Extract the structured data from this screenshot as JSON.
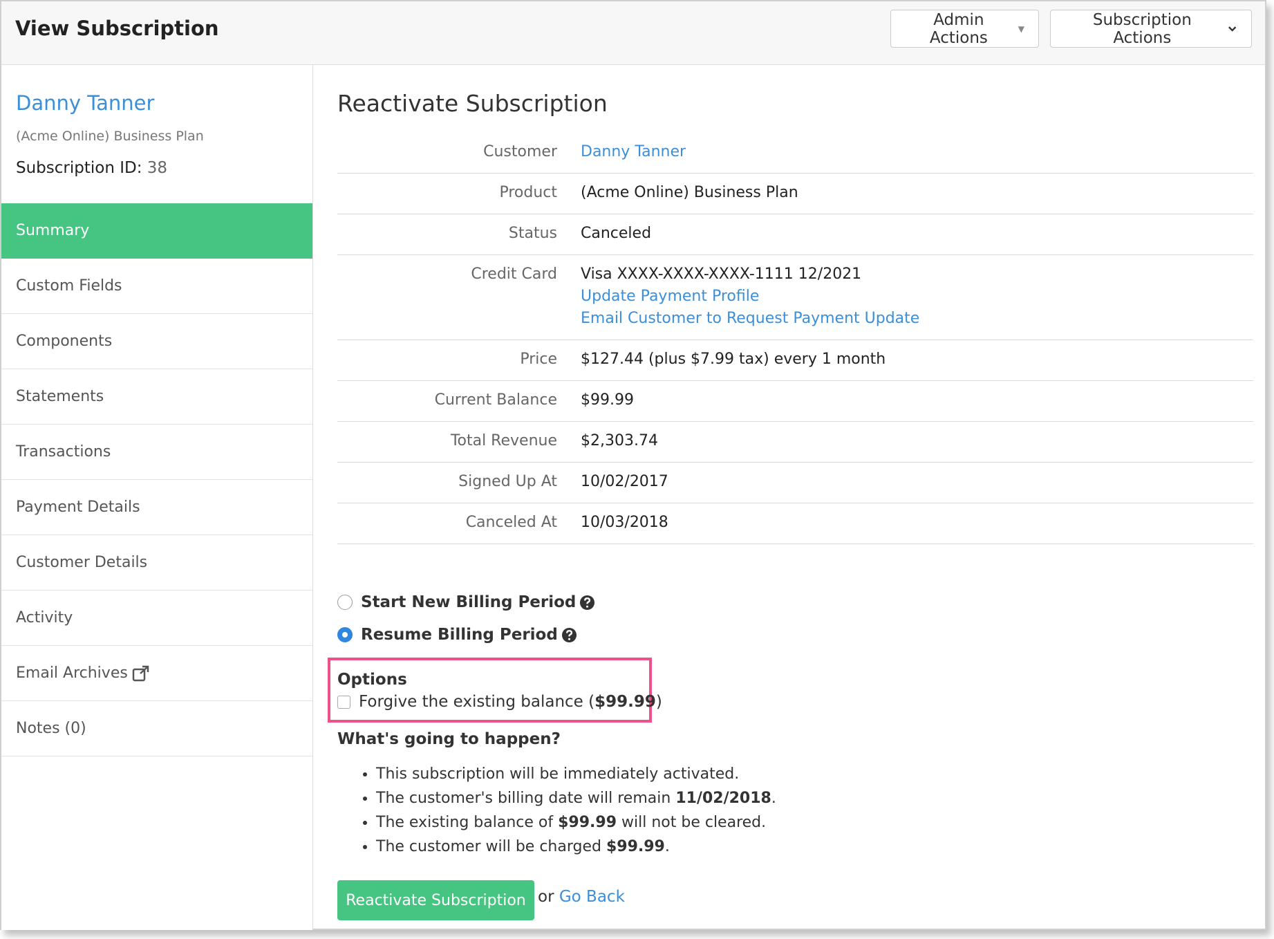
{
  "header": {
    "title": "View Subscription",
    "admin_actions": "Admin Actions",
    "subscription_actions": "Subscription Actions"
  },
  "sidebar": {
    "customer_name": "Danny Tanner",
    "plan": "(Acme Online) Business Plan",
    "subscription_id_label": "Subscription ID:",
    "subscription_id": "38",
    "items": [
      {
        "label": "Summary",
        "active": true
      },
      {
        "label": "Custom Fields"
      },
      {
        "label": "Components"
      },
      {
        "label": "Statements"
      },
      {
        "label": "Transactions"
      },
      {
        "label": "Payment Details"
      },
      {
        "label": "Customer Details"
      },
      {
        "label": "Activity"
      },
      {
        "label": "Email Archives",
        "icon": "external-link-icon"
      },
      {
        "label": "Notes (0)"
      }
    ]
  },
  "main": {
    "title": "Reactivate Subscription",
    "details": [
      {
        "label": "Customer",
        "value": "Danny Tanner"
      },
      {
        "label": "Product",
        "value": "(Acme Online) Business Plan"
      },
      {
        "label": "Status",
        "value": "Canceled"
      },
      {
        "label": "Credit Card",
        "value": "Visa XXXX-XXXX-XXXX-1111 12/2021",
        "link1": "Update Payment Profile",
        "link2": "Email Customer to Request Payment Update"
      },
      {
        "label": "Price",
        "value": "$127.44 (plus $7.99 tax) every 1 month"
      },
      {
        "label": "Current Balance",
        "value": "$99.99"
      },
      {
        "label": "Total Revenue",
        "value": "$2,303.74"
      },
      {
        "label": "Signed Up At",
        "value": "10/02/2017"
      },
      {
        "label": "Canceled At",
        "value": "10/03/2018"
      }
    ],
    "radio_new": "Start New Billing Period",
    "radio_resume": "Resume Billing Period",
    "selected_option": "Resume Billing Period",
    "options_title": "Options",
    "forgive_label": "Forgive the existing balance (",
    "forgive_amount": "$99.99",
    "forgive_close": ")",
    "forgive_checked": false,
    "happen_title": "What's going to happen?",
    "bullets": {
      "b1": "This subscription will be immediately activated.",
      "b2_pre": "The customer's billing date will remain ",
      "b2_bold": "11/02/2018",
      "b2_post": ".",
      "b3_pre": "The existing balance of ",
      "b3_bold": "$99.99",
      "b3_post": " will not be cleared.",
      "b4_pre": "The customer will be charged ",
      "b4_bold": "$99.99",
      "b4_post": "."
    },
    "reactivate_button": "Reactivate Subscription",
    "or_text": "or",
    "go_back": "Go Back"
  },
  "colors": {
    "accent_green": "#46c482",
    "link_blue": "#3b8fd9",
    "highlight_pink": "#f0508a"
  }
}
